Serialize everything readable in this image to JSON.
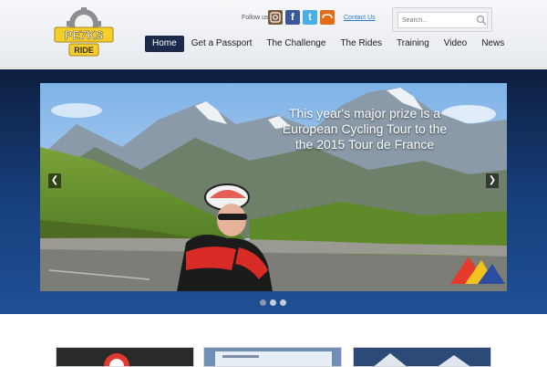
{
  "header": {
    "logo_text": "PE7KS RIDE",
    "follow_label": "Follow us",
    "contact_label": "Contact Us",
    "search": {
      "placeholder": "Search..."
    }
  },
  "social": [
    {
      "name": "instagram-icon"
    },
    {
      "name": "facebook-icon",
      "glyph": "f"
    },
    {
      "name": "twitter-icon",
      "glyph": "t"
    },
    {
      "name": "stumbleupon-icon"
    }
  ],
  "nav": {
    "items": [
      {
        "label": "Home",
        "active": true
      },
      {
        "label": "Get a Passport"
      },
      {
        "label": "The Challenge"
      },
      {
        "label": "The Rides"
      },
      {
        "label": "Training"
      },
      {
        "label": "Video"
      },
      {
        "label": "News"
      }
    ]
  },
  "slider": {
    "caption": "This year's major prize is a European Cycling Tour to the the 2015 Tour de France",
    "prev_glyph": "❮",
    "next_glyph": "❯",
    "dots": 3,
    "active_dot": 0
  },
  "colors": {
    "nav_active": "#1b2a4a",
    "band": "#17407e",
    "link": "#2a7bd0"
  }
}
